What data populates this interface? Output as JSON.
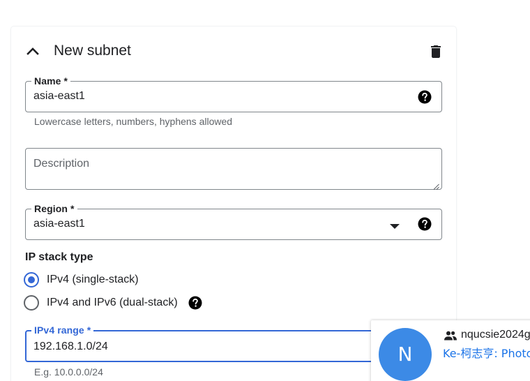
{
  "card": {
    "title": "New subnet",
    "icons": {
      "collapse": "chevron-up-icon",
      "delete": "trash-icon"
    }
  },
  "fields": {
    "name": {
      "label": "Name *",
      "value": "asia-east1",
      "hint": "Lowercase letters, numbers, hyphens allowed",
      "help_icon": "help-icon"
    },
    "description": {
      "placeholder": "Description",
      "value": ""
    },
    "region": {
      "label": "Region *",
      "value": "asia-east1",
      "help_icon": "help-icon",
      "dropdown_icon": "dropdown-arrow-icon"
    },
    "ipv4_range": {
      "label": "IPv4 range *",
      "value": "192.168.1.0/24",
      "hint": "E.g. 10.0.0.0/24"
    }
  },
  "ip_stack": {
    "label": "IP stack type",
    "options": [
      {
        "label": "IPv4 (single-stack)",
        "checked": true
      },
      {
        "label": "IPv4 and IPv6 (dual-stack)",
        "checked": false
      }
    ]
  },
  "notification": {
    "avatar_letter": "N",
    "name": "nqucsie2024g",
    "subtitle": "Ke-柯志亨: Photo",
    "icon": "people-icon"
  },
  "colors": {
    "accent": "#3367d6",
    "border": "#80868b",
    "hint": "#5f6368",
    "avatar": "#3c8ae6",
    "link": "#1a73e8"
  }
}
